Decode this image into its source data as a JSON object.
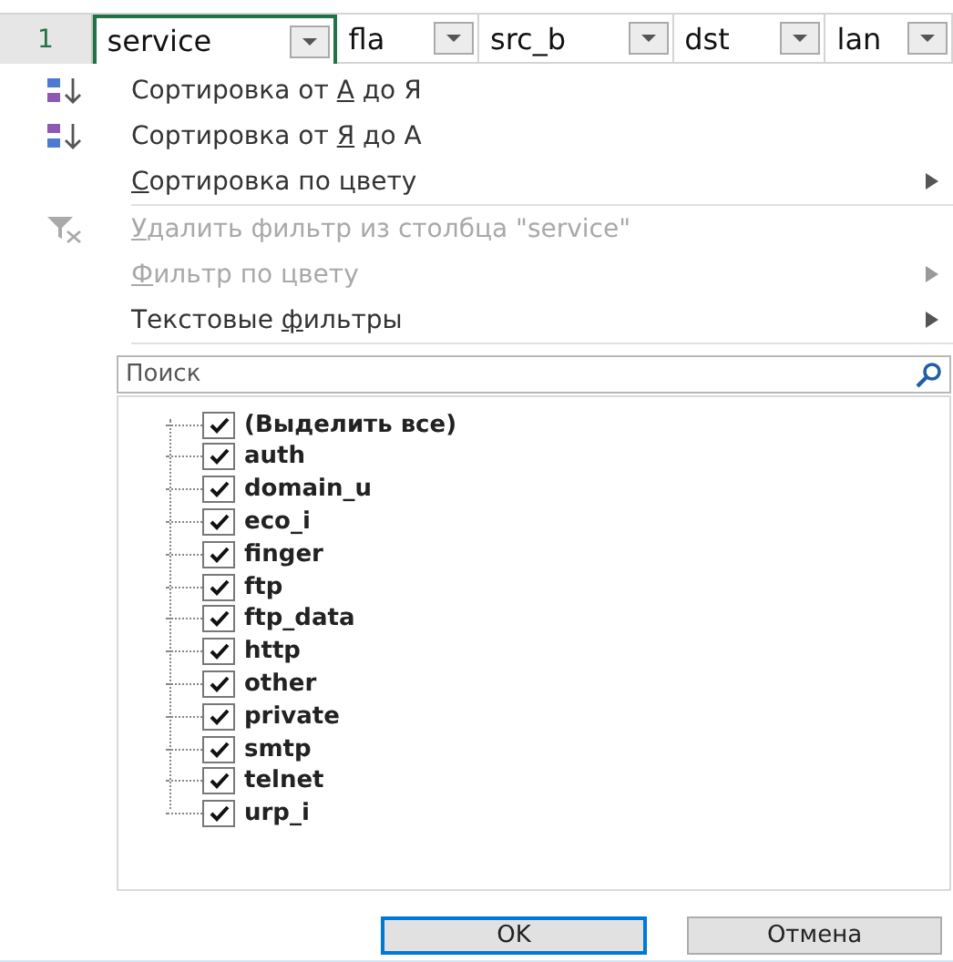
{
  "header_row": {
    "row_number": "1",
    "columns": [
      {
        "label": "service",
        "selected": true
      },
      {
        "label": "fla",
        "selected": false
      },
      {
        "label": "src_b",
        "selected": false
      },
      {
        "label": "dst",
        "selected": false
      },
      {
        "label": "lan",
        "selected": false
      }
    ]
  },
  "menu": [
    {
      "kind": "sort_az",
      "before": "Сортировка от ",
      "key": "А",
      "after": " до Я",
      "disabled": false,
      "submenu": false
    },
    {
      "kind": "sort_za",
      "before": "Сортировка от ",
      "key": "Я",
      "after": " до А",
      "disabled": false,
      "submenu": false
    },
    {
      "kind": "plain",
      "key": "С",
      "after": "ортировка по цвету",
      "disabled": false,
      "submenu": true,
      "divider_after": true
    },
    {
      "kind": "clear_filter",
      "key": "У",
      "after": "далить фильтр из столбца \"service\"",
      "disabled": true,
      "submenu": false
    },
    {
      "kind": "plain",
      "key": "Ф",
      "after": "ильтр по цвету",
      "disabled": true,
      "submenu": true
    },
    {
      "kind": "plain",
      "before": "Текстовые ",
      "key": "ф",
      "after": "ильтры",
      "disabled": false,
      "submenu": true,
      "divider_after": true
    }
  ],
  "search": {
    "placeholder": "Поиск"
  },
  "values": [
    {
      "label": "(Выделить все)",
      "checked": true
    },
    {
      "label": "auth",
      "checked": true
    },
    {
      "label": "domain_u",
      "checked": true
    },
    {
      "label": "eco_i",
      "checked": true
    },
    {
      "label": "finger",
      "checked": true
    },
    {
      "label": "ftp",
      "checked": true
    },
    {
      "label": "ftp_data",
      "checked": true
    },
    {
      "label": "http",
      "checked": true
    },
    {
      "label": "other",
      "checked": true
    },
    {
      "label": "private",
      "checked": true
    },
    {
      "label": "smtp",
      "checked": true
    },
    {
      "label": "telnet",
      "checked": true
    },
    {
      "label": "urp_i",
      "checked": true
    }
  ],
  "buttons": [
    {
      "label": "OK",
      "default": true
    },
    {
      "label": "Отмена",
      "default": false
    }
  ]
}
